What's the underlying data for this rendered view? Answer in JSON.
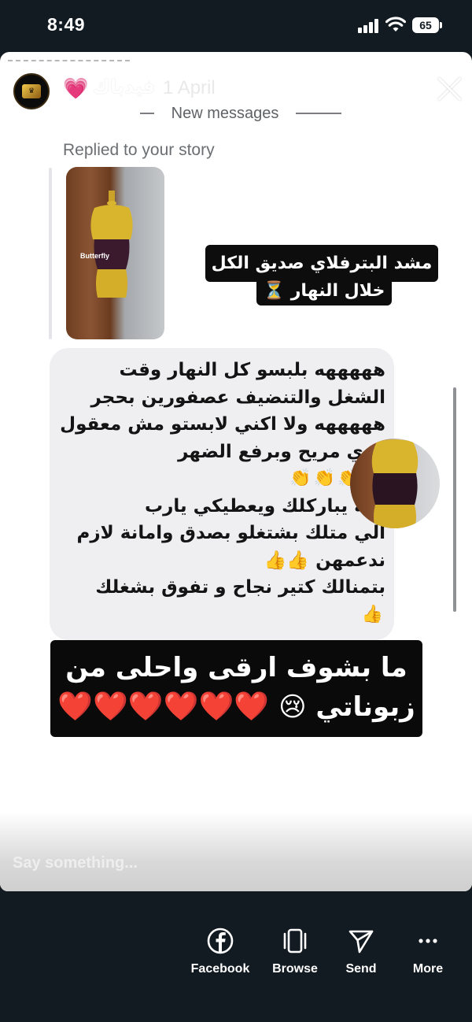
{
  "status_bar": {
    "time": "8:49",
    "battery": "65"
  },
  "story": {
    "header": {
      "emoji": "💗",
      "username": "فيدباك",
      "date": "1 April"
    },
    "divider_label": "New messages",
    "replied_label": "Replied to your story",
    "thumbnail_caption": "Butterfly",
    "caption": {
      "line1": "مشد البترفلاي صديق الكل",
      "line2": "خلال النهار ⏳"
    },
    "message_lines": [
      "هههههه بلبسو كل النهار وقت",
      "الشغل والتنضيف عصفورين بحجر",
      "هههههه ولا اكني لابستو مش معقول",
      "قدي مريح وبرفع الضهر",
      "👏👏👏👏",
      "الله يباركلك ويعطيكي يارب",
      "الي متلك بشتغلو بصدق وامانة لازم",
      "ندعمهن 👍👍",
      "بتمنالك كتير نجاح و تفوق بشغلك",
      "👍"
    ],
    "big_caption": {
      "line1": "ما بشوف ارقى واحلى من",
      "line2_text": "زبوناتي 😢",
      "hearts": "❤️❤️❤️❤️❤️❤️"
    },
    "input_placeholder": "Say something..."
  },
  "actions": [
    {
      "label": "Facebook",
      "icon": "facebook-icon"
    },
    {
      "label": "Browse",
      "icon": "browse-icon"
    },
    {
      "label": "Send",
      "icon": "send-icon"
    },
    {
      "label": "More",
      "icon": "more-icon"
    }
  ],
  "colors": {
    "background": "#121b22",
    "story_background": "#ffffff",
    "bubble": "#efeff2",
    "caption_box": "#0d0d0d",
    "heart": "#e0242f"
  }
}
